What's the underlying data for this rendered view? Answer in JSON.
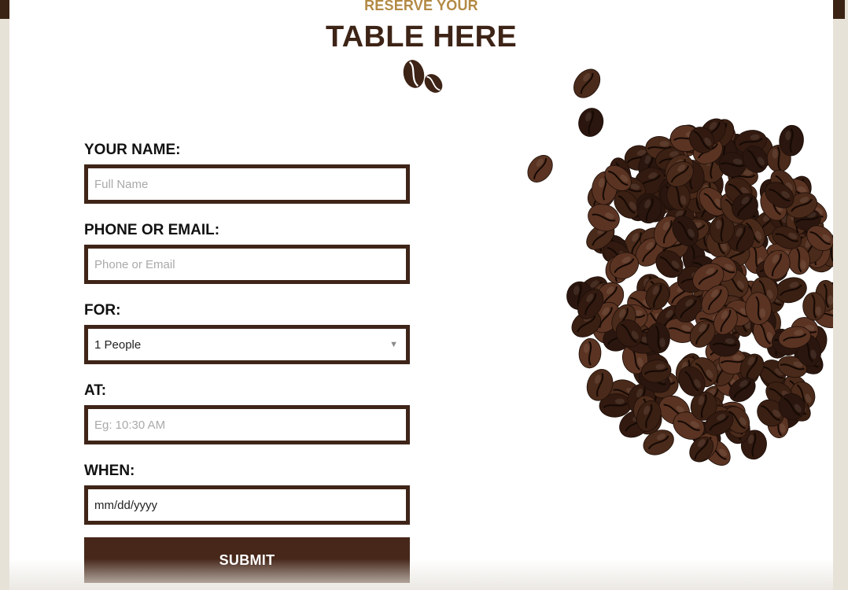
{
  "header": {
    "kicker": "RESERVE YOUR",
    "title": "TABLE HERE"
  },
  "form": {
    "name": {
      "label": "YOUR NAME:",
      "placeholder": "Full Name"
    },
    "contact": {
      "label": "PHONE OR EMAIL:",
      "placeholder": "Phone or Email"
    },
    "party": {
      "label": "FOR:",
      "value": "1 People"
    },
    "time": {
      "label": "AT:",
      "placeholder": "Eg: 10:30 AM"
    },
    "date": {
      "label": "WHEN:",
      "value": "mm/dd/yyyy"
    },
    "submit_label": "SUBMIT"
  },
  "colors": {
    "accent_gold": "#b38a45",
    "brown": "#3f2518",
    "button": "#46271a"
  },
  "icons": {
    "header": "coffee-beans-icon",
    "select": "chevron-down-icon"
  }
}
